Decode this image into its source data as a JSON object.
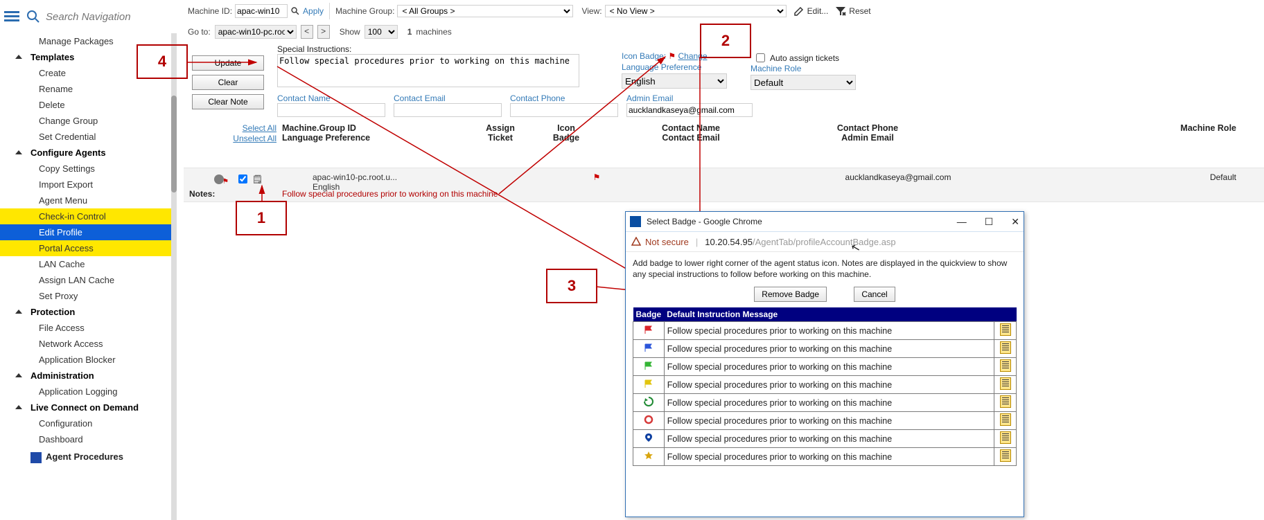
{
  "sidebar": {
    "search_placeholder": "Search Navigation",
    "items": [
      {
        "type": "item",
        "label": "Manage Packages"
      },
      {
        "type": "group",
        "label": "Templates"
      },
      {
        "type": "item",
        "label": "Create"
      },
      {
        "type": "item",
        "label": "Rename"
      },
      {
        "type": "item",
        "label": "Delete"
      },
      {
        "type": "item",
        "label": "Change Group"
      },
      {
        "type": "item",
        "label": "Set Credential"
      },
      {
        "type": "group",
        "label": "Configure Agents"
      },
      {
        "type": "item",
        "label": "Copy Settings"
      },
      {
        "type": "item",
        "label": "Import Export"
      },
      {
        "type": "item",
        "label": "Agent Menu"
      },
      {
        "type": "item",
        "label": "Check-in Control",
        "hl": true
      },
      {
        "type": "item",
        "label": "Edit Profile",
        "hl": true,
        "sel": true
      },
      {
        "type": "item",
        "label": "Portal Access",
        "hl": true
      },
      {
        "type": "item",
        "label": "LAN Cache"
      },
      {
        "type": "item",
        "label": "Assign LAN Cache"
      },
      {
        "type": "item",
        "label": "Set Proxy"
      },
      {
        "type": "group",
        "label": "Protection"
      },
      {
        "type": "item",
        "label": "File Access"
      },
      {
        "type": "item",
        "label": "Network Access"
      },
      {
        "type": "item",
        "label": "Application Blocker"
      },
      {
        "type": "group",
        "label": "Administration"
      },
      {
        "type": "item",
        "label": "Application Logging"
      },
      {
        "type": "group",
        "label": "Live Connect on Demand"
      },
      {
        "type": "item",
        "label": "Configuration"
      },
      {
        "type": "item",
        "label": "Dashboard"
      },
      {
        "type": "root",
        "label": "Agent Procedures"
      }
    ]
  },
  "topbar": {
    "machine_id_label": "Machine ID:",
    "machine_id_value": "apac-win10",
    "apply": "Apply",
    "machine_group_label": "Machine Group:",
    "machine_group_value": "< All Groups >",
    "view_label": "View:",
    "view_value": "< No View >",
    "edit": "Edit...",
    "reset": "Reset"
  },
  "secondbar": {
    "goto_label": "Go to:",
    "goto_value": "apac-win10-pc.root",
    "show_label": "Show",
    "show_value": "100",
    "count_text": "1",
    "count_suffix": "machines"
  },
  "buttons": {
    "update": "Update",
    "clear": "Clear",
    "clear_note": "Clear Note"
  },
  "special": {
    "label": "Special Instructions:",
    "value": "Follow special procedures prior to working on this machine"
  },
  "iconbadge": {
    "label": "Icon Badge:",
    "change": "Change"
  },
  "langpref": {
    "label": "Language Preference",
    "value": "English"
  },
  "autoassign": "Auto assign tickets",
  "machinerole": {
    "label": "Machine Role",
    "value": "Default"
  },
  "contacts": {
    "name_label": "Contact Name",
    "name_value": "",
    "email_label": "Contact Email",
    "email_value": "",
    "phone_label": "Contact Phone",
    "phone_value": "",
    "admin_label": "Admin Email",
    "admin_value": "aucklandkaseya@gmail.com"
  },
  "sel_links": {
    "select_all": "Select All",
    "unselect_all": "Unselect All"
  },
  "headers": {
    "c1a": "Machine.Group ID",
    "c1b": "Language Preference",
    "c2a": "Assign",
    "c2b": "Ticket",
    "c3a": "Icon",
    "c3b": "Badge",
    "c4a": "Contact Name",
    "c4b": "Contact Email",
    "c5a": "Contact Phone",
    "c5b": "Admin Email",
    "c6": "Machine Role"
  },
  "row": {
    "name": "apac-win10-pc.root.u...",
    "lang": "English",
    "note": "Follow special procedures prior to working on this machine",
    "admin": "aucklandkaseya@gmail.com",
    "role": "Default",
    "notes_label": "Notes:"
  },
  "callouts": {
    "c1": "1",
    "c2": "2",
    "c3": "3",
    "c4": "4"
  },
  "popup": {
    "title": "Select Badge - Google Chrome",
    "not_secure": "Not secure",
    "url_path": "/AgentTab/profileAccountBadge.asp",
    "url_host": "10.20.54.95",
    "help": "Add badge to lower right corner of the agent status icon. Notes are displayed in the quickview to show any special instructions to follow before working on this machine.",
    "remove": "Remove Badge",
    "cancel": "Cancel",
    "col_badge": "Badge",
    "col_msg": "Default Instruction Message",
    "rows": [
      {
        "color": "#d9252b",
        "msg": "Follow special procedures prior to working on this machine"
      },
      {
        "color": "#2b55d9",
        "msg": "Follow special procedures prior to working on this machine"
      },
      {
        "color": "#34b535",
        "msg": "Follow special procedures prior to working on this machine"
      },
      {
        "color": "#e2c50e",
        "msg": "Follow special procedures prior to working on this machine"
      },
      {
        "color": "#1f8a33",
        "msg": "Follow special procedures prior to working on this machine",
        "shape": "recycle"
      },
      {
        "color": "#d63a3a",
        "msg": "Follow special procedures prior to working on this machine",
        "shape": "ring"
      },
      {
        "color": "#0d3fa0",
        "msg": "Follow special procedures prior to working on this machine",
        "shape": "pin"
      },
      {
        "color": "#d9a50e",
        "msg": "Follow special procedures prior to working on this machine",
        "shape": "star"
      }
    ]
  }
}
